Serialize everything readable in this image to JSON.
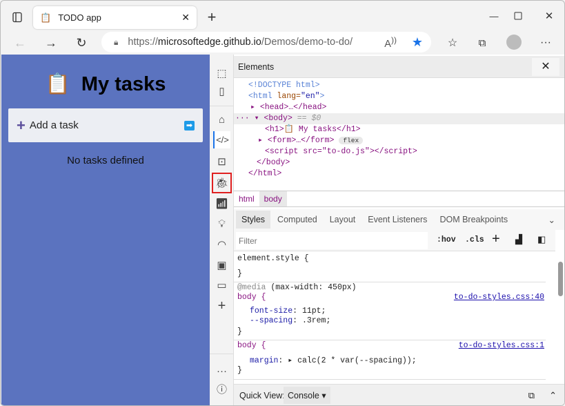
{
  "browser": {
    "tab_title": "TODO app",
    "url_prefix": "https://",
    "url_host": "microsoftedge.github.io",
    "url_path": "/Demos/demo-to-do/"
  },
  "page": {
    "title": "My tasks",
    "add_task": "Add a task",
    "empty": "No tasks defined"
  },
  "devtools": {
    "panel_title": "Elements",
    "dom": [
      {
        "text": "<!DOCTYPE html>"
      },
      {
        "open": "<html",
        "attr": " lang=",
        "val": "\"en\"",
        "close": ">"
      },
      {
        "text": "<head>…</head>"
      },
      {
        "text": "<body>",
        "suffix": " == $0"
      },
      {
        "text": "<h1>📋 My tasks</h1>"
      },
      {
        "text": "<form>…</form>",
        "badge": "flex"
      },
      {
        "text": "<script src=\"to-do.js\"></script>"
      },
      {
        "text": "</body>"
      },
      {
        "text": "</html>"
      }
    ],
    "breadcrumbs": [
      "html",
      "body"
    ],
    "style_tabs": [
      "Styles",
      "Computed",
      "Layout",
      "Event Listeners",
      "DOM Breakpoints"
    ],
    "filter_placeholder": "Filter",
    "hov": ":hov",
    "cls": ".cls",
    "rules": {
      "element_style": "element.style {",
      "close": "}",
      "media": "@media",
      "media_query": " (max-width: 450px)",
      "body_sel": "body {",
      "link1": "to-do-styles.css:40",
      "p1": "font-size",
      "v1": "11pt;",
      "p2": "--spacing",
      "v2": ".3rem;",
      "link2": "to-do-styles.css:1",
      "p3": "margin",
      "v3": "calc(2 * var(--spacing));"
    },
    "quick_view_label": "Quick View:",
    "quick_view_value": "Console"
  }
}
